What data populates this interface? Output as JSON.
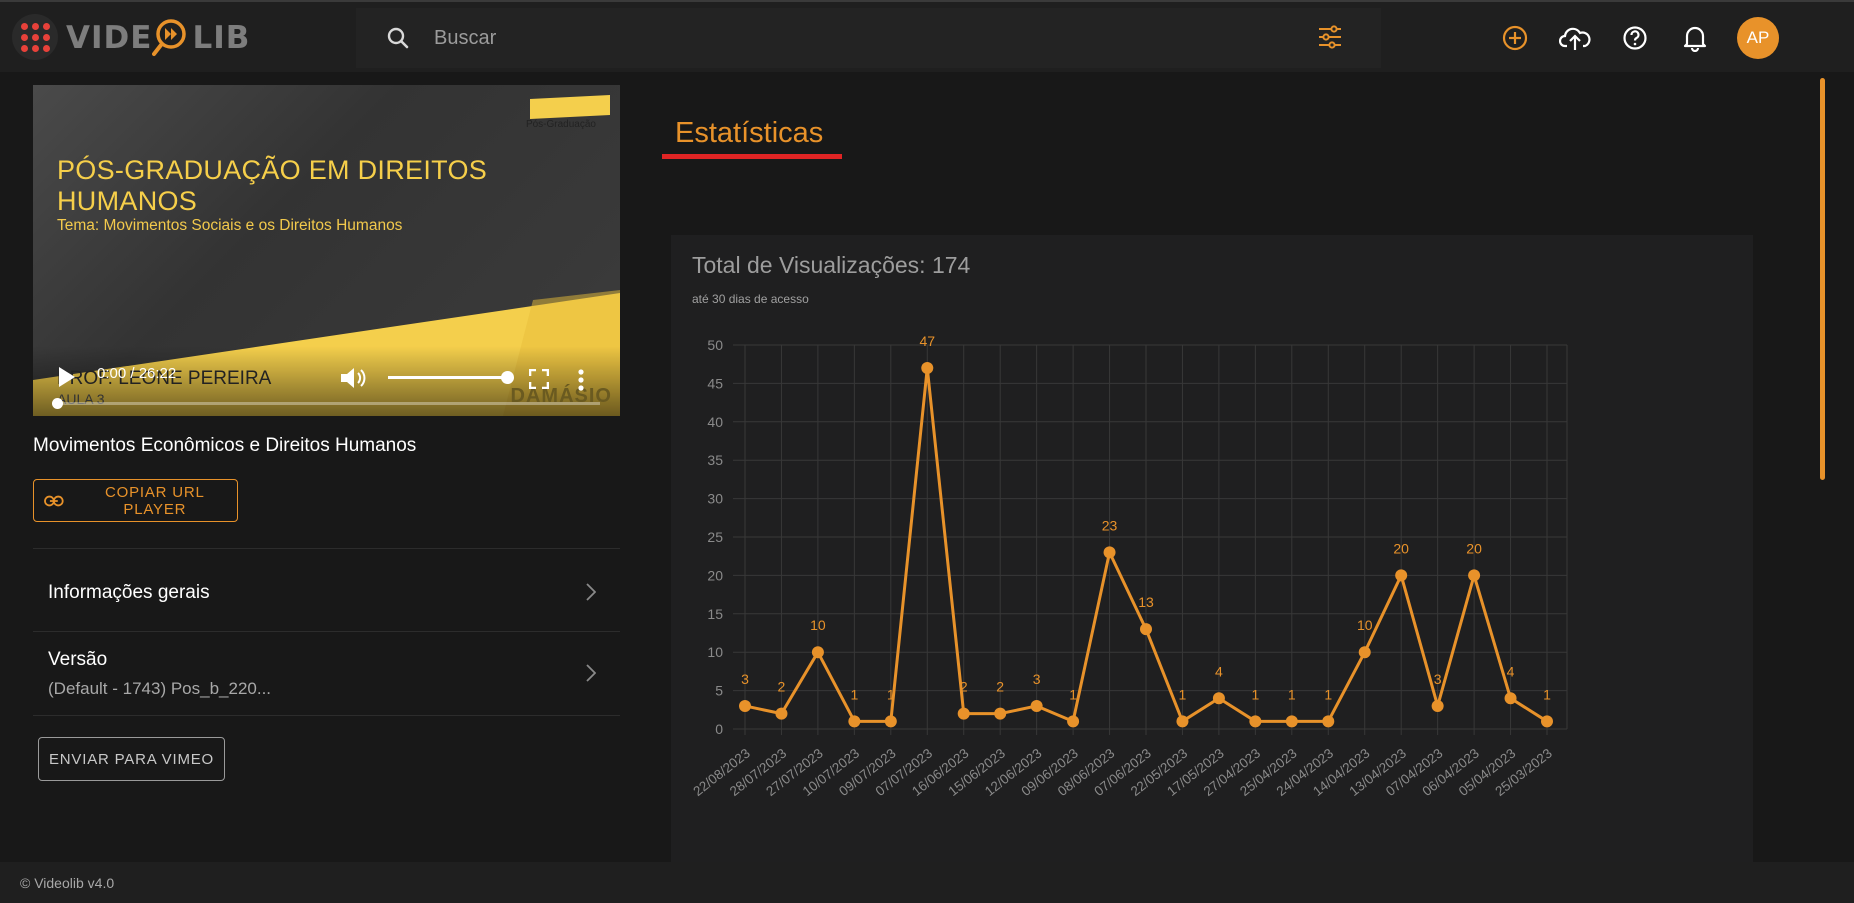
{
  "header": {
    "logo_text_a": "VIDE",
    "logo_text_b": "LIB",
    "search_placeholder": "Buscar",
    "avatar_initials": "AP",
    "icons": [
      "apps-grid-icon",
      "search-icon",
      "filter-sliders-icon",
      "add-circle-icon",
      "cloud-upload-icon",
      "help-icon",
      "bell-icon"
    ]
  },
  "video": {
    "badge": "Pós-Graduação",
    "title": "PÓS-GRADUAÇÃO EM DIREITOS HUMANOS",
    "tema": "Tema: Movimentos Sociais e os Direitos Humanos",
    "professor": "PROF. LEONE PEREIRA",
    "aula": "AULA 3",
    "brand": "DAMÁSIO",
    "time": "0:00 / 26:22",
    "progress_fraction": 0,
    "volume_fraction": 1.0
  },
  "main": {
    "video_name": "Movimentos Econômicos e Direitos Humanos",
    "copy_button": "COPIAR URL PLAYER",
    "accordion": [
      {
        "title": "Informações gerais",
        "subtitle": ""
      },
      {
        "title": "Versão",
        "subtitle": "(Default - 1743) Pos_b_220..."
      }
    ],
    "vimeo_button": "ENVIAR PARA VIMEO"
  },
  "stats": {
    "section_title": "Estatísticas",
    "card_title": "Total de Visualizações: 174",
    "card_subtitle": "até 30 dias de acesso"
  },
  "chart_data": {
    "type": "line",
    "title": "Total de Visualizações: 174",
    "subtitle": "até 30 dias de acesso",
    "categories": [
      "22/08/2023",
      "28/07/2023",
      "27/07/2023",
      "10/07/2023",
      "09/07/2023",
      "07/07/2023",
      "16/06/2023",
      "15/06/2023",
      "12/06/2023",
      "09/06/2023",
      "08/06/2023",
      "07/06/2023",
      "22/05/2023",
      "17/05/2023",
      "27/04/2023",
      "25/04/2023",
      "24/04/2023",
      "14/04/2023",
      "13/04/2023",
      "07/04/2023",
      "06/04/2023",
      "05/04/2023",
      "25/03/2023"
    ],
    "values": [
      3,
      2,
      10,
      1,
      1,
      47,
      2,
      2,
      3,
      1,
      23,
      13,
      1,
      4,
      1,
      1,
      1,
      10,
      20,
      3,
      20,
      4,
      1
    ],
    "ylim": [
      0,
      50
    ],
    "yticks": [
      0,
      5,
      10,
      15,
      20,
      25,
      30,
      35,
      40,
      45,
      50
    ],
    "grid": true,
    "data_labels": true,
    "color": "#e8922a"
  },
  "footer": {
    "text": "© Videolib v4.0"
  },
  "colors": {
    "accent": "#e8922a",
    "underline": "#e02424",
    "apps_dots": "#e8413a"
  }
}
